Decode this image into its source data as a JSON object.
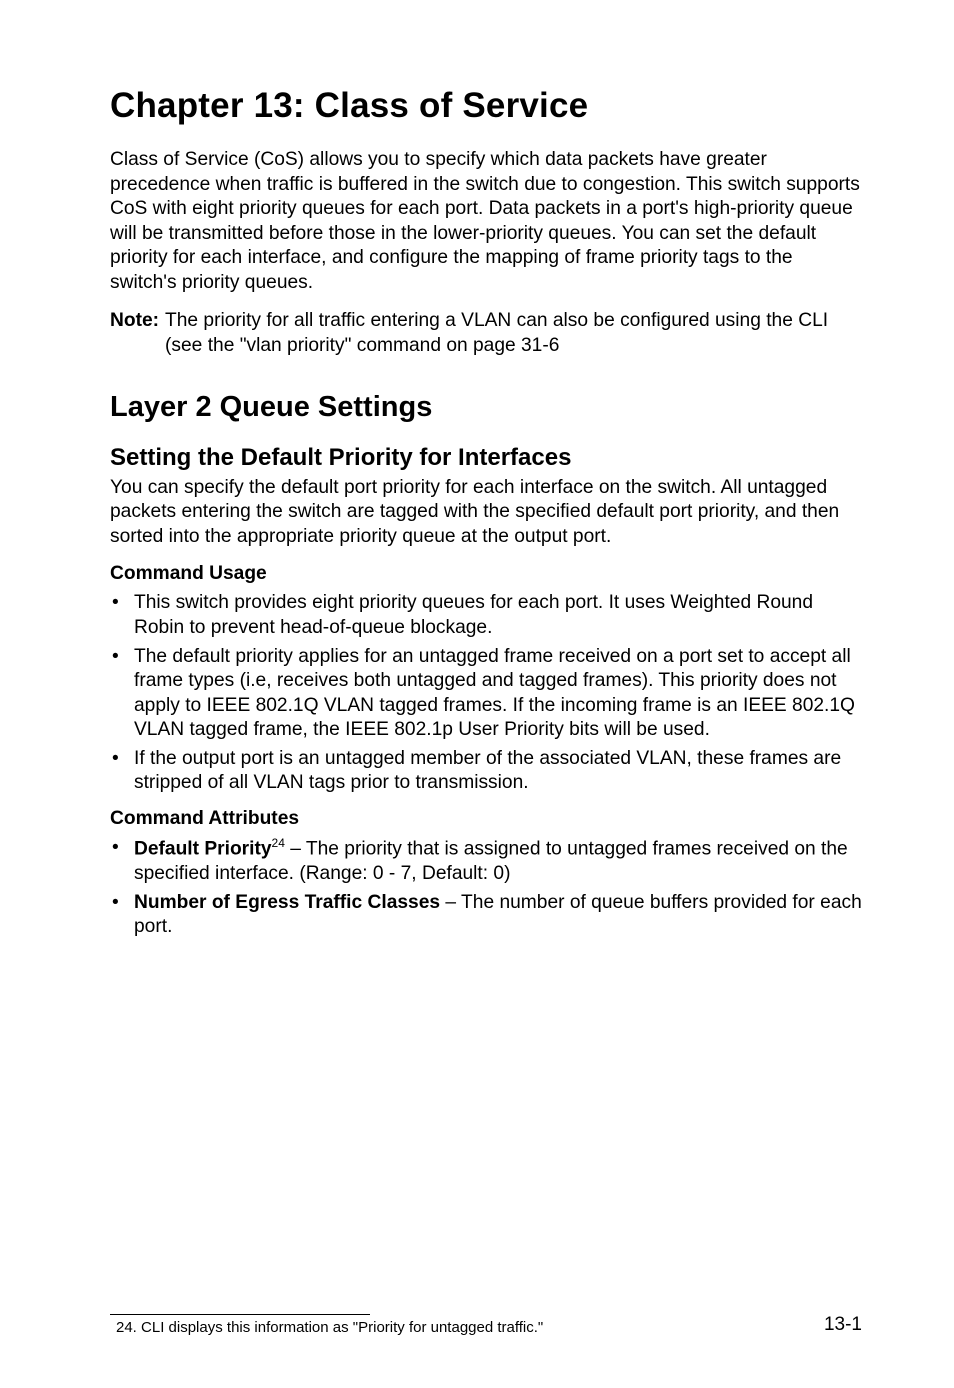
{
  "chapter_title": "Chapter 13: Class of Service",
  "intro_para": "Class of Service (CoS) allows you to specify which data packets have greater precedence when traffic is buffered in the switch due to congestion. This switch supports CoS with eight priority queues for each port. Data packets in a port's high-priority queue will be transmitted before those in the lower-priority queues. You can set the default priority for each interface, and configure the mapping of frame priority tags to the switch's priority queues.",
  "note": {
    "label": "Note:",
    "text": "The priority for all traffic entering a VLAN can also be configured using the CLI (see the \"vlan priority\" command on page 31-6"
  },
  "section_h2": "Layer 2 Queue Settings",
  "section_h3": "Setting the Default Priority for Interfaces",
  "section_intro": "You can specify the default port priority for each interface on the switch. All untagged packets entering the switch are tagged with the specified default port priority, and then sorted into the appropriate priority queue at the output port.",
  "command_usage": {
    "heading": "Command Usage",
    "items": [
      "This switch provides eight priority queues for each port. It uses Weighted Round Robin to prevent head-of-queue blockage.",
      "The default priority applies for an untagged frame received on a port set to accept all frame types (i.e, receives both untagged and tagged frames). This priority does not apply to IEEE 802.1Q VLAN tagged frames. If the incoming frame is an IEEE 802.1Q VLAN tagged frame, the IEEE 802.1p User Priority bits will be used.",
      "If the output port is an untagged member of the associated VLAN, these frames are stripped of all VLAN tags prior to transmission."
    ]
  },
  "command_attributes": {
    "heading": "Command Attributes",
    "items": [
      {
        "lead": "Default Priority",
        "sup": "24",
        "rest": " – The priority that is assigned to untagged frames received on the specified interface. (Range: 0 - 7, Default: 0)"
      },
      {
        "lead": "Number of Egress Traffic Classes",
        "sup": "",
        "rest": " – The number of queue buffers provided for each port."
      }
    ]
  },
  "footnote": {
    "marker": "24.",
    "text": "CLI displays this information as \"Priority for untagged traffic.\""
  },
  "page_number": "13-1"
}
